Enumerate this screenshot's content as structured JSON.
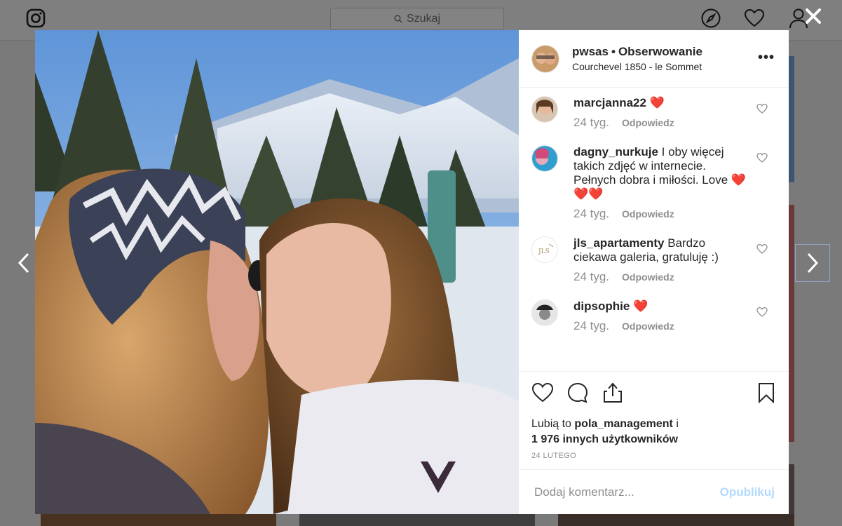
{
  "header": {
    "search_placeholder": "Szukaj",
    "icons": [
      "instagram-logo-icon",
      "search-icon",
      "compass-icon",
      "heart-icon",
      "user-icon"
    ]
  },
  "modal": {
    "close_label": "✕",
    "post": {
      "username": "pwsas",
      "separator": "•",
      "follow_label": "Obserwowanie",
      "location": "Courchevel 1850 - le Sommet",
      "more_label": "•••"
    },
    "comments": [
      {
        "user": "marcjanna22",
        "text": "❤️",
        "time": "24 tyg.",
        "reply": "Odpowiedz"
      },
      {
        "user": "dagny_nurkuje",
        "text": "I oby więcej takich zdjęć w internecie. Pełnych dobra i miłości. Love ❤️❤️❤️",
        "time": "24 tyg.",
        "reply": "Odpowiedz"
      },
      {
        "user": "jls_apartamenty",
        "text": "Bardzo ciekawa galeria, gratuluję :)",
        "time": "24 tyg.",
        "reply": "Odpowiedz"
      },
      {
        "user": "dipsophie",
        "text": "❤️",
        "time": "24 tyg.",
        "reply": "Odpowiedz"
      }
    ],
    "likes": {
      "prefix": "Lubią to",
      "user": "pola_management",
      "conj": "i",
      "others": "1 976 innych użytkowników"
    },
    "date": "24 LUTEGO",
    "comment_input": {
      "placeholder": "Dodaj komentarz...",
      "value": ""
    },
    "publish_label": "Opublikuj"
  },
  "colors": {
    "overlay": "#7a7a7a",
    "text": "#262626",
    "muted": "#8e8e8e",
    "publish_disabled": "#b3dbff",
    "heart_red": "#ed4956"
  }
}
